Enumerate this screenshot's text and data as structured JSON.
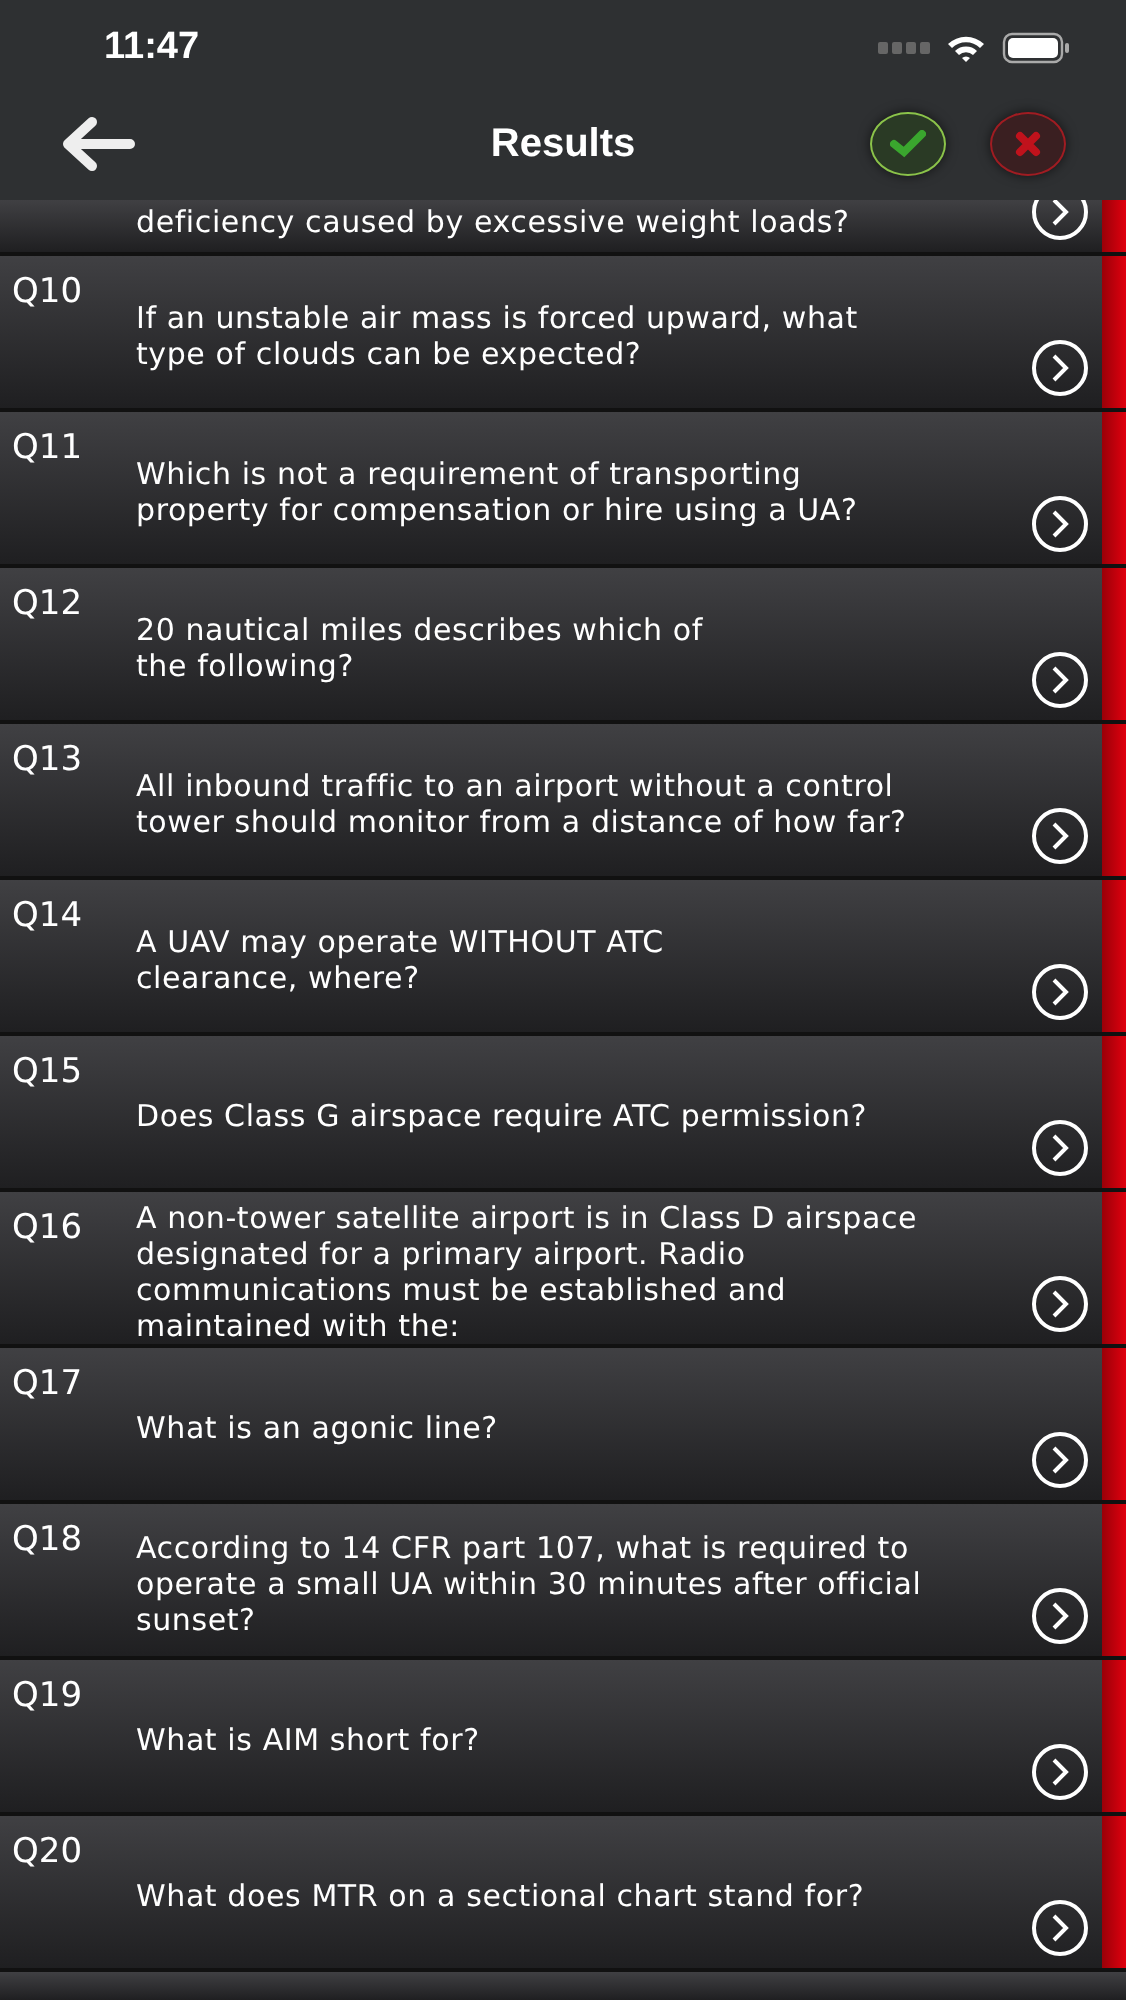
{
  "status_bar": {
    "time": "11:47"
  },
  "header": {
    "title": "Results"
  },
  "filters": [
    {
      "kind": "correct",
      "selected": false
    },
    {
      "kind": "incorrect",
      "selected": false
    }
  ],
  "partial_question": {
    "text": "deficiency caused by excessive weight loads?",
    "correct": false
  },
  "questions": [
    {
      "number": "Q10",
      "text": "If an unstable air mass is forced upward, what\ntype of clouds can be expected?",
      "correct": false
    },
    {
      "number": "Q11",
      "text": "Which is not a requirement of transporting\nproperty for compensation or hire using a UA?",
      "correct": false
    },
    {
      "number": "Q12",
      "text": "20 nautical miles describes which of\nthe following?",
      "correct": false
    },
    {
      "number": "Q13",
      "text": "All inbound traffic to an airport without a control\ntower should monitor from a distance of how far?",
      "correct": false
    },
    {
      "number": "Q14",
      "text": "A UAV may operate WITHOUT ATC\nclearance, where?",
      "correct": false
    },
    {
      "number": "Q15",
      "text": "Does Class G airspace require ATC permission?",
      "correct": false
    },
    {
      "number": "Q16",
      "text": "A non-tower satellite airport is in Class D airspace\ndesignated for a primary airport. Radio\ncommunications must be established and\nmaintained with the:",
      "correct": false
    },
    {
      "number": "Q17",
      "text": "What is an agonic line?",
      "correct": false
    },
    {
      "number": "Q18",
      "text": "According to 14 CFR part 107, what is required to\noperate a small UA within 30 minutes after official\nsunset?",
      "correct": false
    },
    {
      "number": "Q19",
      "text": "What is AIM short for?",
      "correct": false
    },
    {
      "number": "Q20",
      "text": "What does MTR on a sectional chart stand for?",
      "correct": false
    }
  ]
}
